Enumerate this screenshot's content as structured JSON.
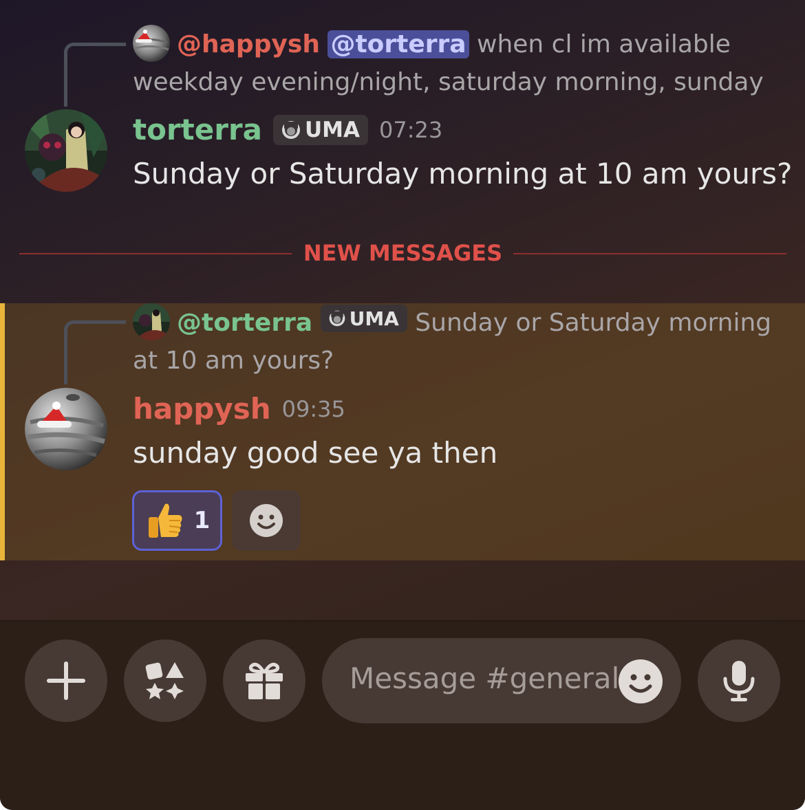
{
  "messages": {
    "first": {
      "reply": {
        "author": "@happysh",
        "mention": "@torterra",
        "text_line1": " when cl im available",
        "text_line2": "weekday evening/night, saturday morning, sunday ..."
      },
      "author": "torterra",
      "tag": "UMA",
      "time": "07:23",
      "text": "Sunday or Saturday morning at 10 am yours?"
    },
    "new_messages_label": "NEW MESSAGES",
    "second": {
      "reply": {
        "author": "@torterra",
        "tag": "UMA",
        "text_line1": " Sunday or Saturday morning",
        "text_line2": "at 10 am yours?"
      },
      "author": "happysh",
      "time": "09:35",
      "text": "sunday good see ya then",
      "reactions": [
        {
          "emoji": "👍",
          "count": "1",
          "selected": true
        }
      ]
    }
  },
  "composer": {
    "placeholder": "Message #general",
    "buttons": [
      "plus-icon",
      "apps-icon",
      "gift-icon",
      "microphone-icon"
    ]
  },
  "colors": {
    "name_happysh": "#e06455",
    "name_torterra": "#79c38f",
    "mention_bg": "#4b4f9a",
    "new_messages": "#e0514a",
    "highlight_bar": "#e8b53a",
    "reaction_border": "#5d62d8"
  }
}
